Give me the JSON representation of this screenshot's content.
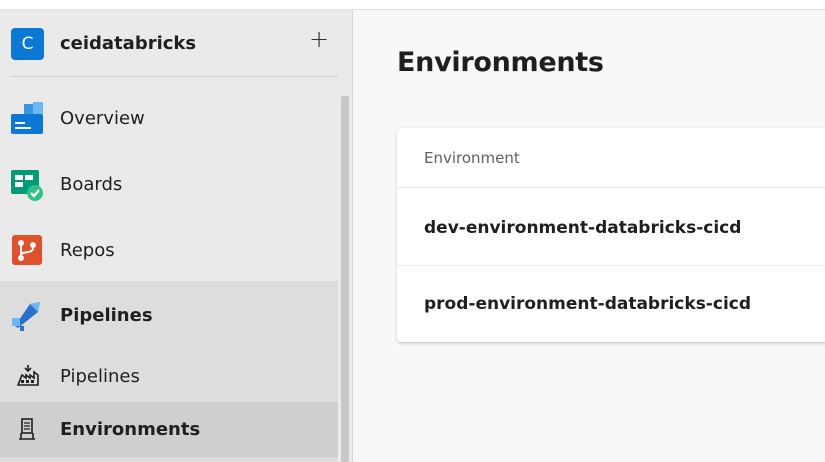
{
  "organization": {
    "initial": "C",
    "name": "ceidatabricks",
    "add_symbol": "+"
  },
  "nav": {
    "overview": "Overview",
    "boards": "Boards",
    "repos": "Repos",
    "pipelines": "Pipelines",
    "sub_items": [
      {
        "label": "Pipelines",
        "icon": "pipelines-sub-icon"
      },
      {
        "label": "Environments",
        "icon": "environments-icon",
        "selected": true
      }
    ]
  },
  "page": {
    "title": "Environments",
    "table": {
      "column_header": "Environment",
      "rows": [
        "dev-environment-databricks-cicd",
        "prod-environment-databricks-cicd"
      ]
    }
  },
  "colors": {
    "accent": "#0a78d4",
    "sidebar_bg": "#eaeaea",
    "selected_bg": "#cfcfcf",
    "group_bg": "#dddddd"
  }
}
